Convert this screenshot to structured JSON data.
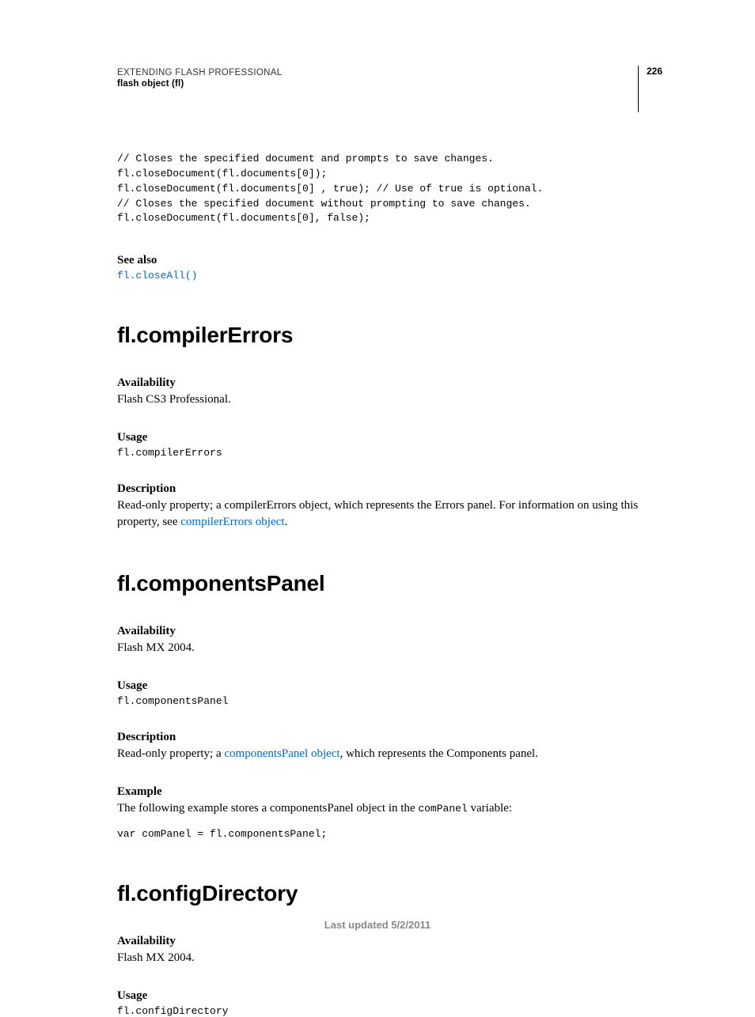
{
  "header": {
    "title": "EXTENDING FLASH PROFESSIONAL",
    "subtitle": "flash object (fl)",
    "page_number": "226"
  },
  "intro_code": "// Closes the specified document and prompts to save changes.\nfl.closeDocument(fl.documents[0]);\nfl.closeDocument(fl.documents[0] , true); // Use of true is optional.\n// Closes the specified document without prompting to save changes.\nfl.closeDocument(fl.documents[0], false);",
  "see_also": {
    "label": "See also",
    "link": "fl.closeAll()"
  },
  "sections": [
    {
      "heading": "fl.compilerErrors",
      "availability_label": "Availability",
      "availability_text": "Flash CS3 Professional.",
      "usage_label": "Usage",
      "usage_code": "fl.compilerErrors",
      "description_label": "Description",
      "description_pre": "Read-only property; a compilerErrors object, which represents the Errors panel. For information on using this property, see ",
      "description_link": "compilerErrors object",
      "description_post": "."
    },
    {
      "heading": "fl.componentsPanel",
      "availability_label": "Availability",
      "availability_text": "Flash MX 2004.",
      "usage_label": "Usage",
      "usage_code": "fl.componentsPanel",
      "description_label": "Description",
      "description_pre": "Read-only property; a ",
      "description_link": "componentsPanel object",
      "description_post": ", which represents the Components panel.",
      "example_label": "Example",
      "example_text_pre": "The following example stores a componentsPanel object in the ",
      "example_text_mono": "comPanel",
      "example_text_post": " variable:",
      "example_code": "var comPanel = fl.componentsPanel;"
    },
    {
      "heading": "fl.configDirectory",
      "availability_label": "Availability",
      "availability_text": "Flash MX 2004.",
      "usage_label": "Usage",
      "usage_code": "fl.configDirectory"
    }
  ],
  "footer": "Last updated 5/2/2011"
}
